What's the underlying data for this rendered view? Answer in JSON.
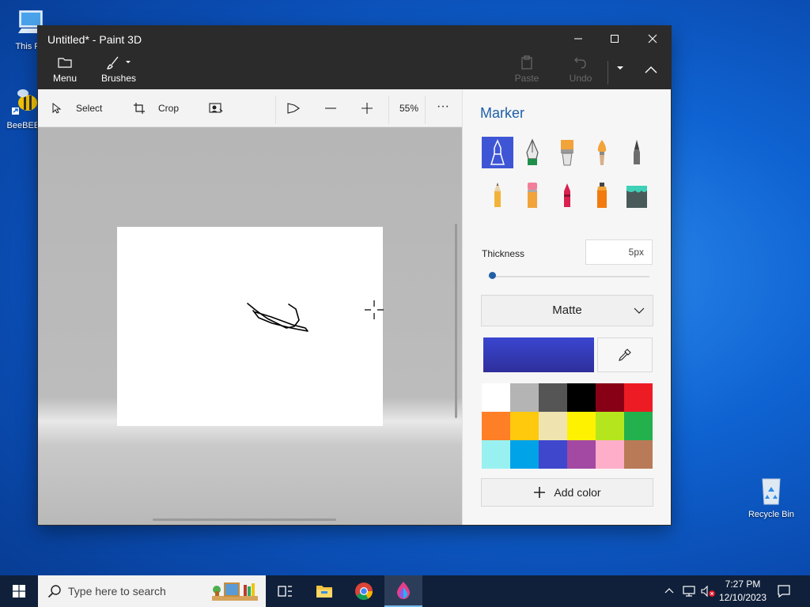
{
  "desktop": {
    "icons": [
      {
        "label": "This PC"
      },
      {
        "label": "BeeBEEP"
      },
      {
        "label": "Recycle Bin"
      }
    ]
  },
  "window": {
    "title": "Untitled* - Paint 3D",
    "ribbon": {
      "menu_label": "Menu",
      "brushes_label": "Brushes",
      "paste_label": "Paste",
      "undo_label": "Undo"
    }
  },
  "toolbar": {
    "select_label": "Select",
    "crop_label": "Crop",
    "zoom_level": "55%",
    "more_label": "···"
  },
  "panel": {
    "title": "Marker",
    "brushes": [
      {
        "name": "marker",
        "selected": true
      },
      {
        "name": "calligraphy-pen"
      },
      {
        "name": "oil-brush"
      },
      {
        "name": "watercolor"
      },
      {
        "name": "pixel-pen"
      },
      {
        "name": "pencil"
      },
      {
        "name": "eraser"
      },
      {
        "name": "crayon"
      },
      {
        "name": "spray-can"
      },
      {
        "name": "fill"
      }
    ],
    "thickness_label": "Thickness",
    "thickness_value": "5px",
    "thickness_level_percent": 1,
    "finish_value": "Matte",
    "current_color": "#3a46d0",
    "palette": [
      "#ffffff",
      "#b4b4b4",
      "#555555",
      "#000000",
      "#880015",
      "#ed1c24",
      "#ff7f27",
      "#ffc90e",
      "#efe4b0",
      "#fff200",
      "#b5e61d",
      "#22b14c",
      "#99f0f0",
      "#00a2e8",
      "#3f48cc",
      "#a349a4",
      "#ffaec9",
      "#b97a57"
    ],
    "add_color_label": "Add color"
  },
  "taskbar": {
    "search_placeholder": "Type here to search",
    "time": "7:27 PM",
    "date": "12/10/2023"
  }
}
